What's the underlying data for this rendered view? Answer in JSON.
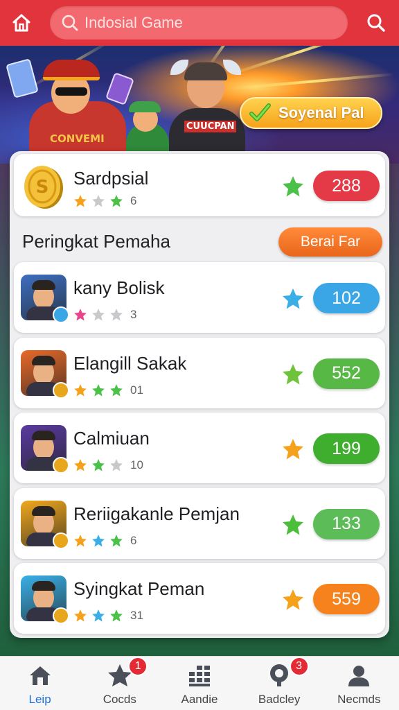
{
  "topbar": {
    "search_placeholder": "Indosial Game"
  },
  "hero": {
    "shirt_text_left": "CONVEMI",
    "shirt_text_right": "CUUCPAN",
    "cta_label": "Soyenal Pal"
  },
  "featured": {
    "name": "Sardpsial",
    "stars": [
      "orange",
      "gray",
      "green"
    ],
    "count": "6",
    "score": "288",
    "score_color": "#e43a47",
    "big_star_color": "#4cc14a"
  },
  "section": {
    "title": "Peringkat Pemaha",
    "button_label": "Berai Far"
  },
  "players": [
    {
      "name": "kany Bolisk",
      "stars": [
        "pink",
        "gray",
        "gray"
      ],
      "count": "3",
      "score": "102",
      "score_color": "#3aa6e6",
      "big_star_color": "#3aaee6",
      "avatar_bg": "#3d6fc0"
    },
    {
      "name": "Elangill Sakak",
      "stars": [
        "orange",
        "green",
        "green"
      ],
      "count": "01",
      "score": "552",
      "score_color": "#58b845",
      "big_star_color": "#6fc33a",
      "avatar_bg": "#e86a2a"
    },
    {
      "name": "Calmiuan",
      "stars": [
        "orange",
        "green",
        "gray"
      ],
      "count": "10",
      "score": "199",
      "score_color": "#3fae2f",
      "big_star_color": "#f6a11c",
      "avatar_bg": "#5a3aa0"
    },
    {
      "name": "Reriigakanle Pemjan",
      "stars": [
        "orange",
        "blue",
        "green"
      ],
      "count": "6",
      "score": "133",
      "score_color": "#5cbd58",
      "big_star_color": "#4cbf3a",
      "avatar_bg": "#f0a81e"
    },
    {
      "name": "Syingkat Peman",
      "stars": [
        "orange",
        "blue",
        "green"
      ],
      "count": "31",
      "score": "559",
      "score_color": "#f5821c",
      "big_star_color": "#f6a11c",
      "avatar_bg": "#3ab0e8"
    }
  ],
  "nav": [
    {
      "label": "Leip",
      "icon": "home-icon",
      "badge": ""
    },
    {
      "label": "Cocds",
      "icon": "star-icon",
      "badge": "1"
    },
    {
      "label": "Aandie",
      "icon": "grid-icon",
      "badge": ""
    },
    {
      "label": "Badcley",
      "icon": "badge-icon",
      "badge": "3"
    },
    {
      "label": "Necmds",
      "icon": "user-icon",
      "badge": ""
    }
  ],
  "colors": {
    "topbar": "#e2343c",
    "active_nav": "#1e6fd6",
    "star_orange": "#f6a11c",
    "star_green": "#4cc14a",
    "star_gray": "#c9c9cc",
    "star_blue": "#3aaee6",
    "star_pink": "#e8458a"
  }
}
